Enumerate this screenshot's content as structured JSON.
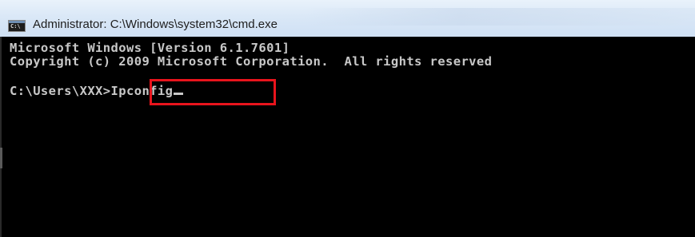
{
  "window": {
    "title": "Administrator: C:\\Windows\\system32\\cmd.exe",
    "app_icon": "cmd-icon",
    "app_icon_glyph": "C:\\"
  },
  "console": {
    "lines": [
      "Microsoft Windows [Version 6.1.7601]",
      "Copyright (c) 2009 Microsoft Corporation.  All rights reserved",
      ""
    ],
    "prompt": "C:\\Users\\XXX>",
    "command": "Ipconfig",
    "background_color": "#000000",
    "text_color": "#c8c8c8"
  },
  "annotation": {
    "highlight_color": "#e8141c"
  }
}
